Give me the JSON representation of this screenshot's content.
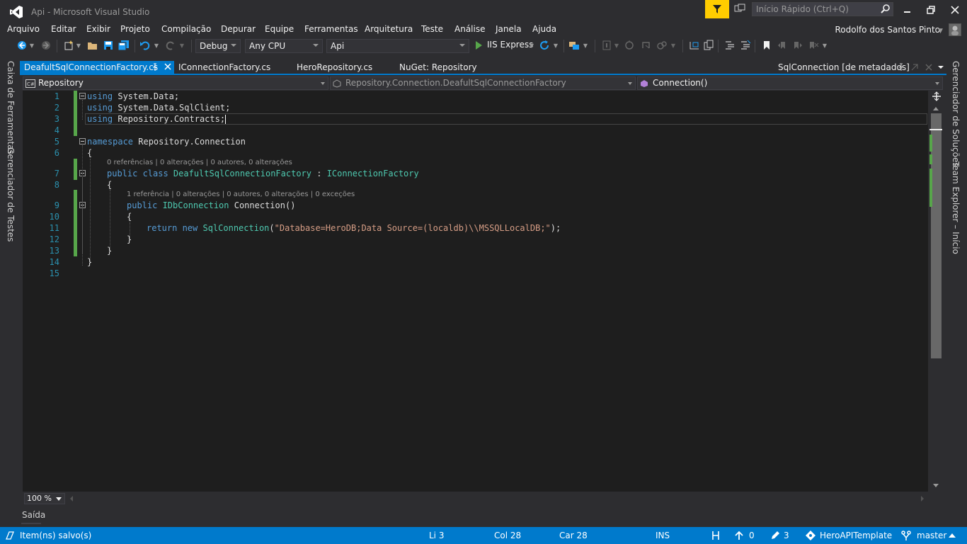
{
  "window": {
    "title": "Api - Microsoft Visual Studio",
    "quick_launch_placeholder": "Início Rápido (Ctrl+Q)",
    "user": "Rodolfo dos Santos Pinto"
  },
  "menu": [
    "Arquivo",
    "Editar",
    "Exibir",
    "Projeto",
    "Compilação",
    "Depurar",
    "Equipe",
    "Ferramentas",
    "Arquitetura",
    "Teste",
    "Análise",
    "Janela",
    "Ajuda"
  ],
  "toolbar": {
    "config": "Debug",
    "platform": "Any CPU",
    "project": "Api",
    "run_target": "IIS Express"
  },
  "left_rail": [
    "Caixa de Ferramentas",
    "Gerenciador de Testes"
  ],
  "right_rail": [
    "Gerenciador de Soluções",
    "Team Explorer – Início"
  ],
  "tabs": {
    "items": [
      {
        "label": "DeafultSqlConnectionFactory.cs",
        "active": true
      },
      {
        "label": "IConnectionFactory.cs",
        "active": false
      },
      {
        "label": "HeroRepository.cs",
        "active": false
      },
      {
        "label": "NuGet: Repository",
        "active": false
      }
    ],
    "preview": "SqlConnection [de metadados]"
  },
  "navbar": {
    "project": "Repository",
    "type": "Repository.Connection.DeafultSqlConnectionFactory",
    "member": "Connection()"
  },
  "code": {
    "line_numbers": [
      "1",
      "2",
      "3",
      "4",
      "5",
      "6",
      "7",
      "8",
      "9",
      "10",
      "11",
      "12",
      "13",
      "14",
      "15"
    ],
    "lens_class": "0 referências | 0 alterações | 0 autores, 0 alterações",
    "lens_method": "1 referência | 0 alterações | 0 autores, 0 alterações | 0 exceções",
    "l1_kw": "using",
    "l1_rest": " System.Data;",
    "l2_kw": "using",
    "l2_rest": " System.Data.SqlClient;",
    "l3_kw": "using",
    "l3_rest": " Repository.Contracts;",
    "l5_kw": "namespace",
    "l5_rest": " Repository.Connection",
    "open_brace": "{",
    "close_brace": "}",
    "l7_kw": "public class ",
    "l7_type": "DeafultSqlConnectionFactory",
    "l7_colon": " : ",
    "l7_iface": "IConnectionFactory",
    "l9_kw": "public ",
    "l9_type": "IDbConnection",
    "l9_rest": " Connection()",
    "l11_kw": "return new ",
    "l11_type": "SqlConnection",
    "l11_open": "(",
    "l11_str": "\"Database=HeroDB;Data Source=(localdb)\\\\MSSQLLocalDB;\"",
    "l11_close": ");"
  },
  "zoom": "100 %",
  "output_tab": "Saída",
  "status": {
    "message": "Item(ns) salvo(s)",
    "line": "Li 3",
    "col": "Col 28",
    "car": "Car 28",
    "mode": "INS",
    "up_count": "0",
    "edit_count": "3",
    "repo": "HeroAPITemplate",
    "branch": "master"
  },
  "colors": {
    "accent": "#007acc",
    "keyword": "#569cd6",
    "type": "#4ec9b0",
    "string": "#d69d85",
    "line_number": "#2b91af",
    "change_bar": "#57a64a",
    "filter": "#ffcc00"
  }
}
